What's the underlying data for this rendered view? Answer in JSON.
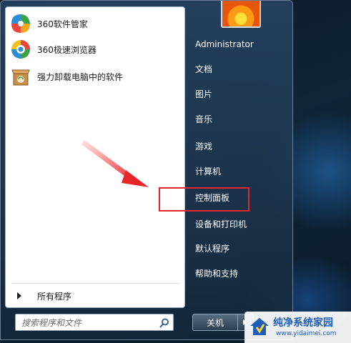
{
  "programs": [
    {
      "label": "360软件管家",
      "icon": "360-software-manager-icon"
    },
    {
      "label": "360极速浏览器",
      "icon": "360-browser-icon"
    },
    {
      "label": "强力卸载电脑中的软件",
      "icon": "uninstaller-box-icon"
    }
  ],
  "all_programs_label": "所有程序",
  "search": {
    "placeholder": "搜索程序和文件",
    "icon": "search-icon"
  },
  "user": {
    "name": "Administrator"
  },
  "right_items": [
    "文档",
    "图片",
    "音乐",
    "游戏",
    "计算机",
    "控制面板",
    "设备和打印机",
    "默认程序",
    "帮助和支持"
  ],
  "shutdown_label": "关机",
  "highlighted_item": "控制面板",
  "colors": {
    "highlight": "#e8262a",
    "menu_text": "#ffffff",
    "watermark_blue": "#1d5fb8"
  },
  "watermark": {
    "title": "纯净系统家园",
    "url": "www.yidaimei.com"
  }
}
